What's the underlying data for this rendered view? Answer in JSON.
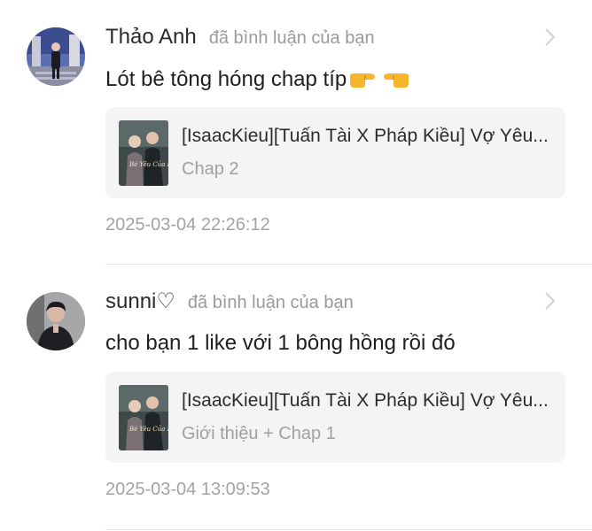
{
  "notifications": [
    {
      "username": "Thảo Anh",
      "action": "đã bình luận của bạn",
      "comment": "Lót bê tông hóng chap típ",
      "comment_emoji": [
        "pointing-right-emoji",
        "pointing-left-emoji"
      ],
      "card": {
        "title": "[IsaacKieu][Tuấn Tài X Pháp Kiều] Vợ Yêu...",
        "subtitle": "Chap 2",
        "thumb_text": "Bé Yêu Của Em Tổng"
      },
      "timestamp": "2025-03-04 22:26:12",
      "avatar_icon": "user-avatar-photo"
    },
    {
      "username": "sunni♡",
      "action": "đã bình luận của bạn",
      "comment": "cho bạn 1 like với 1 bông hồng rồi đó",
      "comment_emoji": [],
      "card": {
        "title": "[IsaacKieu][Tuấn Tài X Pháp Kiều] Vợ Yêu...",
        "subtitle": "Giới thiệu + Chap 1",
        "thumb_text": "Bé Yêu Của Em Tổng"
      },
      "timestamp": "2025-03-04 13:09:53",
      "avatar_icon": "user-avatar-photo"
    }
  ],
  "colors": {
    "card_bg": "#f4f4f4",
    "muted_text": "#9a9a9a",
    "primary_text": "#1f1f1f",
    "divider": "#e6e6e6"
  }
}
